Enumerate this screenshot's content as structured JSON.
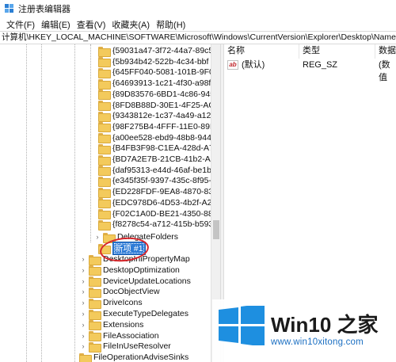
{
  "window": {
    "title": "注册表编辑器"
  },
  "menu": [
    "文件(F)",
    "编辑(E)",
    "查看(V)",
    "收藏夹(A)",
    "帮助(H)"
  ],
  "address": "计算机\\HKEY_LOCAL_MACHINE\\SOFTWARE\\Microsoft\\Windows\\CurrentVersion\\Explorer\\Desktop\\NameSpace",
  "tree": {
    "guid_keys": [
      "{59031a47-3f72-44a7-89c5",
      "{5b934b42-522b-4c34-bbf",
      "{645FF040-5081-101B-9F08",
      "{64693913-1c21-4f30-a98f",
      "{89D83576-6BD1-4c86-945",
      "{8FD8B88D-30E1-4F25-AC2",
      "{9343812e-1c37-4a49-a12e",
      "{98F275B4-4FFF-11E0-89E2",
      "{a00ee528-ebd9-48b8-944",
      "{B4FB3F98-C1EA-428d-A78",
      "{BD7A2E7B-21CB-41b2-A0",
      "{daf95313-e44d-46af-be1b",
      "{e345f35f-9397-435c-8f95-",
      "{ED228FDF-9EA8-4870-83b",
      "{EDC978D6-4D53-4b2f-A26",
      "{F02C1A0D-BE21-4350-88B",
      "{f8278c54-a712-415b-b593"
    ],
    "delegate_folders": "DelegateFolders",
    "new_key": "新项 #1",
    "sibling_keys": [
      "DesktopIniPropertyMap",
      "DesktopOptimization",
      "DeviceUpdateLocations",
      "DocObjectView",
      "DriveIcons",
      "ExecuteTypeDelegates",
      "Extensions",
      "FileAssociation",
      "FileInUseResolver",
      "FileOperationAdviseSinks"
    ]
  },
  "values": {
    "columns": [
      "名称",
      "类型",
      "数据"
    ],
    "rows": [
      {
        "name": "(默认)",
        "type": "REG_SZ",
        "data": "(数值"
      }
    ]
  },
  "watermark": {
    "title": "Win10 之家",
    "url": "www.win10xitong.com"
  },
  "colors": {
    "selection": "#2e7bd6",
    "annotation": "#d8262b",
    "folder": "#f3ca5c",
    "logo": "#1e8fe0"
  }
}
